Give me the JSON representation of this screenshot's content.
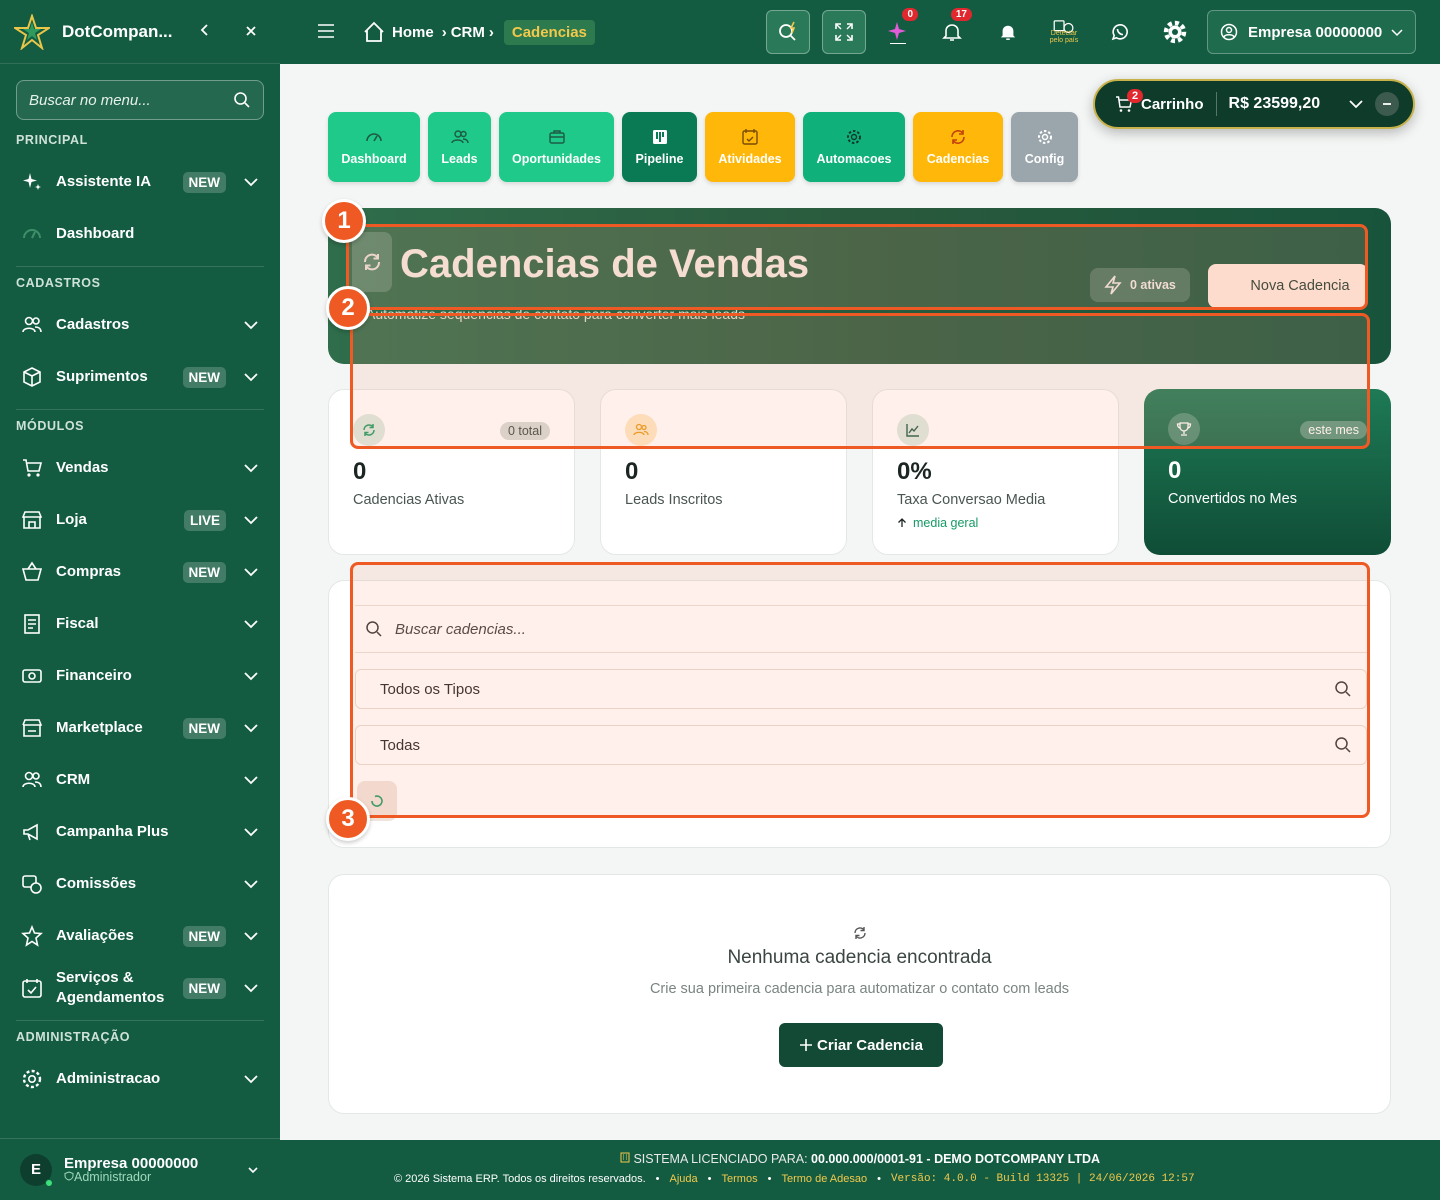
{
  "sidebar": {
    "brand": "DotCompan...",
    "search_placeholder": "Buscar no menu...",
    "sections": {
      "principal": "PRINCIPAL",
      "cadastros": "CADASTROS",
      "modulos": "MÓDULOS",
      "administracao": "ADMINISTRAÇÃO"
    },
    "items": {
      "assistente": {
        "label": "Assistente IA",
        "badge": "NEW"
      },
      "dashboard": {
        "label": "Dashboard"
      },
      "cadastros": {
        "label": "Cadastros"
      },
      "suprimentos": {
        "label": "Suprimentos",
        "badge": "NEW"
      },
      "vendas": {
        "label": "Vendas"
      },
      "loja": {
        "label": "Loja",
        "badge": "LIVE"
      },
      "compras": {
        "label": "Compras",
        "badge": "NEW"
      },
      "fiscal": {
        "label": "Fiscal"
      },
      "financeiro": {
        "label": "Financeiro"
      },
      "marketplace": {
        "label": "Marketplace",
        "badge": "NEW"
      },
      "crm": {
        "label": "CRM"
      },
      "campanha": {
        "label": "Campanha Plus"
      },
      "comissoes": {
        "label": "Comissões"
      },
      "avaliacoes": {
        "label": "Avaliações",
        "badge": "NEW"
      },
      "servicos": {
        "label_1": "Serviços &",
        "label_2": "Agendamentos",
        "badge": "NEW"
      },
      "administracao": {
        "label": "Administracao"
      }
    },
    "user": {
      "initial": "E",
      "name": "Empresa 00000000",
      "role": "Administrador"
    }
  },
  "topbar": {
    "breadcrumb": [
      "Home",
      "CRM",
      "Cadencias"
    ],
    "ai_badge": "0",
    "notif_badge": "17",
    "detect_label_1": "Detectar",
    "detect_label_2": "pelo país",
    "company": "Empresa 00000000"
  },
  "cart": {
    "badge": "2",
    "label": "Carrinho",
    "total": "R$ 23599,20"
  },
  "modules": {
    "dashboard": "Dashboard",
    "leads": "Leads",
    "oportunidades": "Oportunidades",
    "pipeline": "Pipeline",
    "atividades": "Atividades",
    "automacoes": "Automacoes",
    "cadencias": "Cadencias",
    "config": "Config"
  },
  "hero": {
    "title": "Cadencias de Vendas",
    "subtitle": "Automatize sequencias de contato para converter mais leads",
    "active_count": "0 ativas",
    "new_button": "Nova Cadencia"
  },
  "stats": {
    "ativas": {
      "value": "0",
      "label": "Cadencias Ativas",
      "pill": "0 total"
    },
    "leads": {
      "value": "0",
      "label": "Leads Inscritos"
    },
    "conversao": {
      "value": "0%",
      "label": "Taxa Conversao Media",
      "note": "media geral"
    },
    "convertidos": {
      "value": "0",
      "label": "Convertidos no Mes",
      "pill": "este mes"
    }
  },
  "filters": {
    "search_placeholder": "Buscar cadencias...",
    "type_select": "Todos os Tipos",
    "status_select": "Todas"
  },
  "empty": {
    "title": "Nenhuma cadencia encontrada",
    "description": "Crie sua primeira cadencia para automatizar o contato com leads",
    "button": "Criar Cadencia"
  },
  "annotations": {
    "one": "1",
    "two": "2",
    "three": "3"
  },
  "footer": {
    "license_prefix": "SISTEMA LICENCIADO PARA:",
    "license_value": "00.000.000/0001-91 - DEMO DOTCOMPANY LTDA",
    "copyright": "© 2026 Sistema ERP. Todos os direitos reservados.",
    "links": [
      "Ajuda",
      "Termos",
      "Termo de Adesao"
    ],
    "version": "Versão: 4.0.0 - Build 13325 | 24/06/2026 12:57"
  },
  "colors": {
    "primary": "#135c42",
    "accent": "#f2c94c",
    "highlight": "#ef5a24"
  }
}
